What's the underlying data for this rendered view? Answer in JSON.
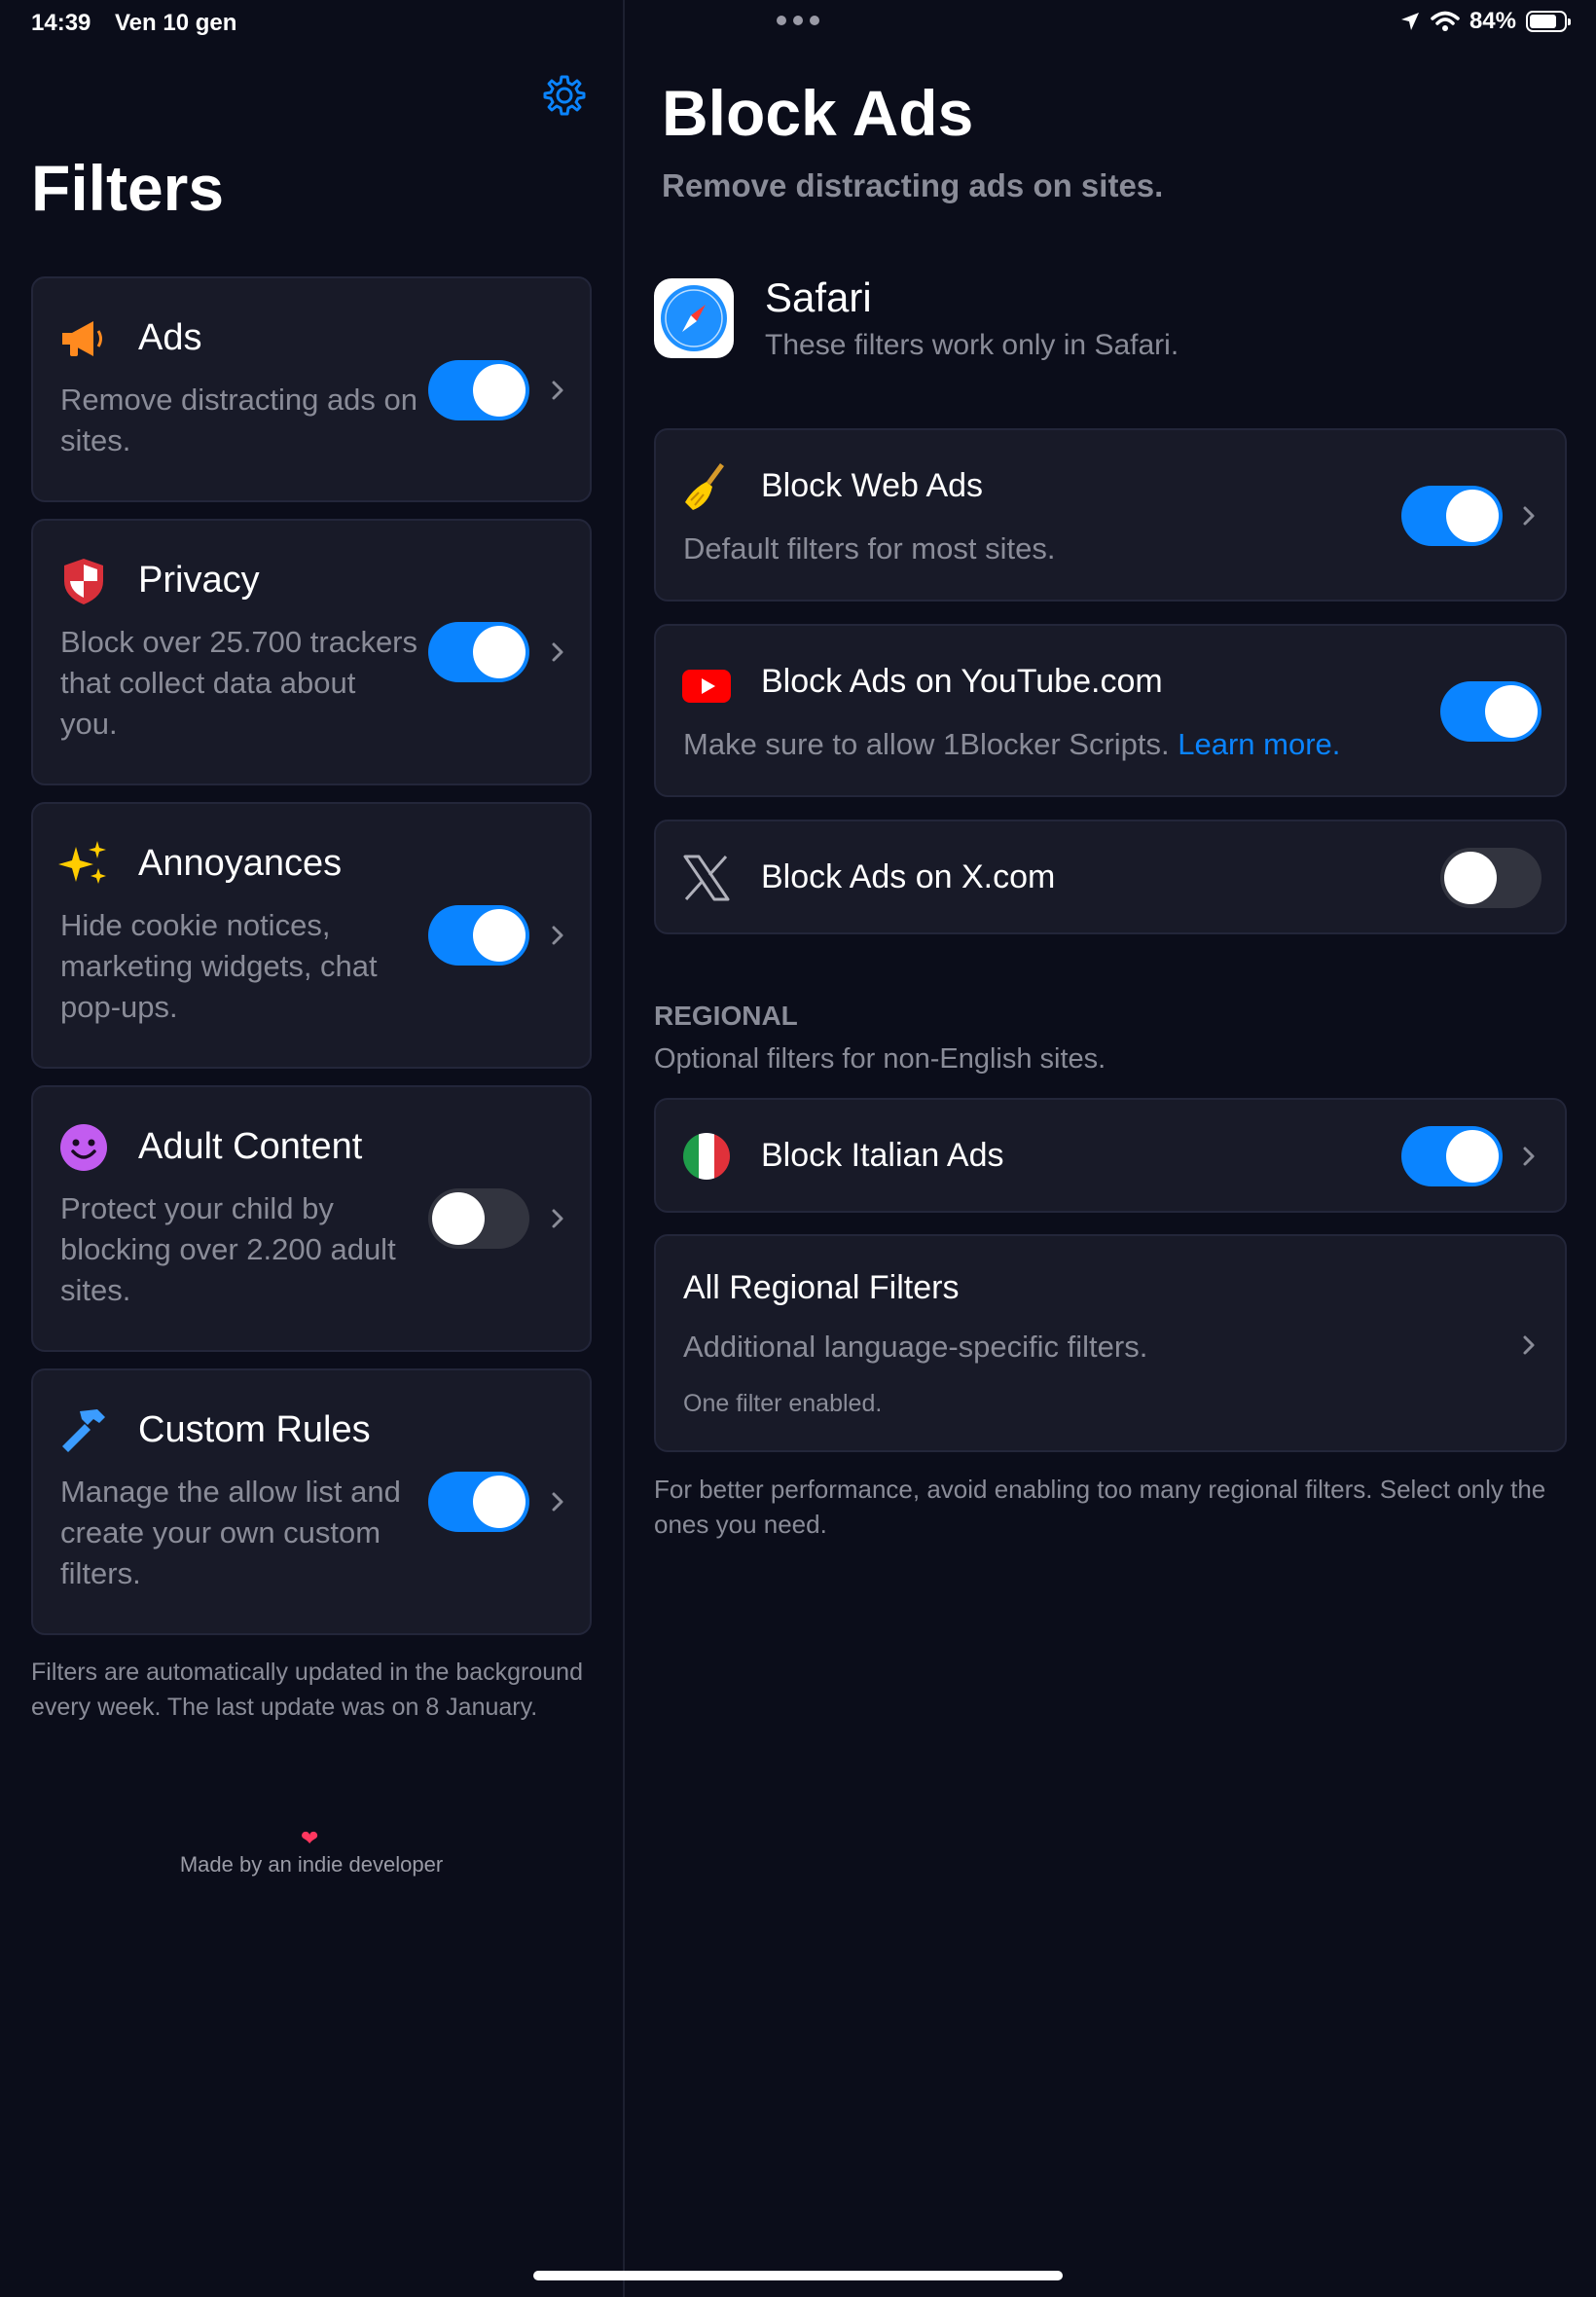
{
  "status_bar": {
    "time": "14:39",
    "date": "Ven 10 gen",
    "battery": "84%",
    "battery_level": 0.84
  },
  "sidebar": {
    "title": "Filters",
    "cards": [
      {
        "title": "Ads",
        "description": "Remove distracting ads on sites.",
        "enabled": true,
        "icon": "megaphone-icon"
      },
      {
        "title": "Privacy",
        "description": "Block over 25.700 trackers that collect data about you.",
        "enabled": true,
        "icon": "shield-icon"
      },
      {
        "title": "Annoyances",
        "description": "Hide cookie notices, marketing widgets, chat pop-ups.",
        "enabled": true,
        "icon": "sparkles-icon"
      },
      {
        "title": "Adult Content",
        "description": "Protect your child by blocking over 2.200 adult sites.",
        "enabled": false,
        "icon": "smiley-icon"
      },
      {
        "title": "Custom Rules",
        "description": "Manage the allow list and create your own custom filters.",
        "enabled": true,
        "icon": "hammer-icon"
      }
    ],
    "footnote": "Filters are automatically updated in the background every week. The last update was on 8 January.",
    "heart": "❤",
    "made_by": "Made by an indie developer"
  },
  "detail": {
    "title": "Block Ads",
    "subtitle": "Remove distracting ads on sites.",
    "browser": {
      "name": "Safari",
      "description": "These filters work only in Safari."
    },
    "filters": [
      {
        "title": "Block Web Ads",
        "description": "Default filters for most sites.",
        "enabled": true,
        "icon": "broom-icon"
      },
      {
        "title": "Block Ads on YouTube.com",
        "description": "Make sure to allow 1Blocker Scripts.",
        "link": "Learn more.",
        "enabled": true,
        "icon": "youtube-icon"
      },
      {
        "title": "Block Ads on X.com",
        "enabled": false,
        "icon": "x-logo-icon"
      }
    ],
    "regional": {
      "heading": "REGIONAL",
      "subheading": "Optional filters for non-English sites.",
      "italian": {
        "title": "Block Italian Ads",
        "enabled": true,
        "icon": "italy-flag-icon"
      },
      "all": {
        "title": "All Regional Filters",
        "description": "Additional language-specific filters.",
        "status": "One filter enabled."
      }
    },
    "footnote": "For better performance, avoid enabling too many regional filters. Select only the ones you need."
  },
  "colors": {
    "background": "#0b0d1a",
    "card": "#181a28",
    "accent": "#0a84ff",
    "secondary_text": "#8a8c98"
  }
}
